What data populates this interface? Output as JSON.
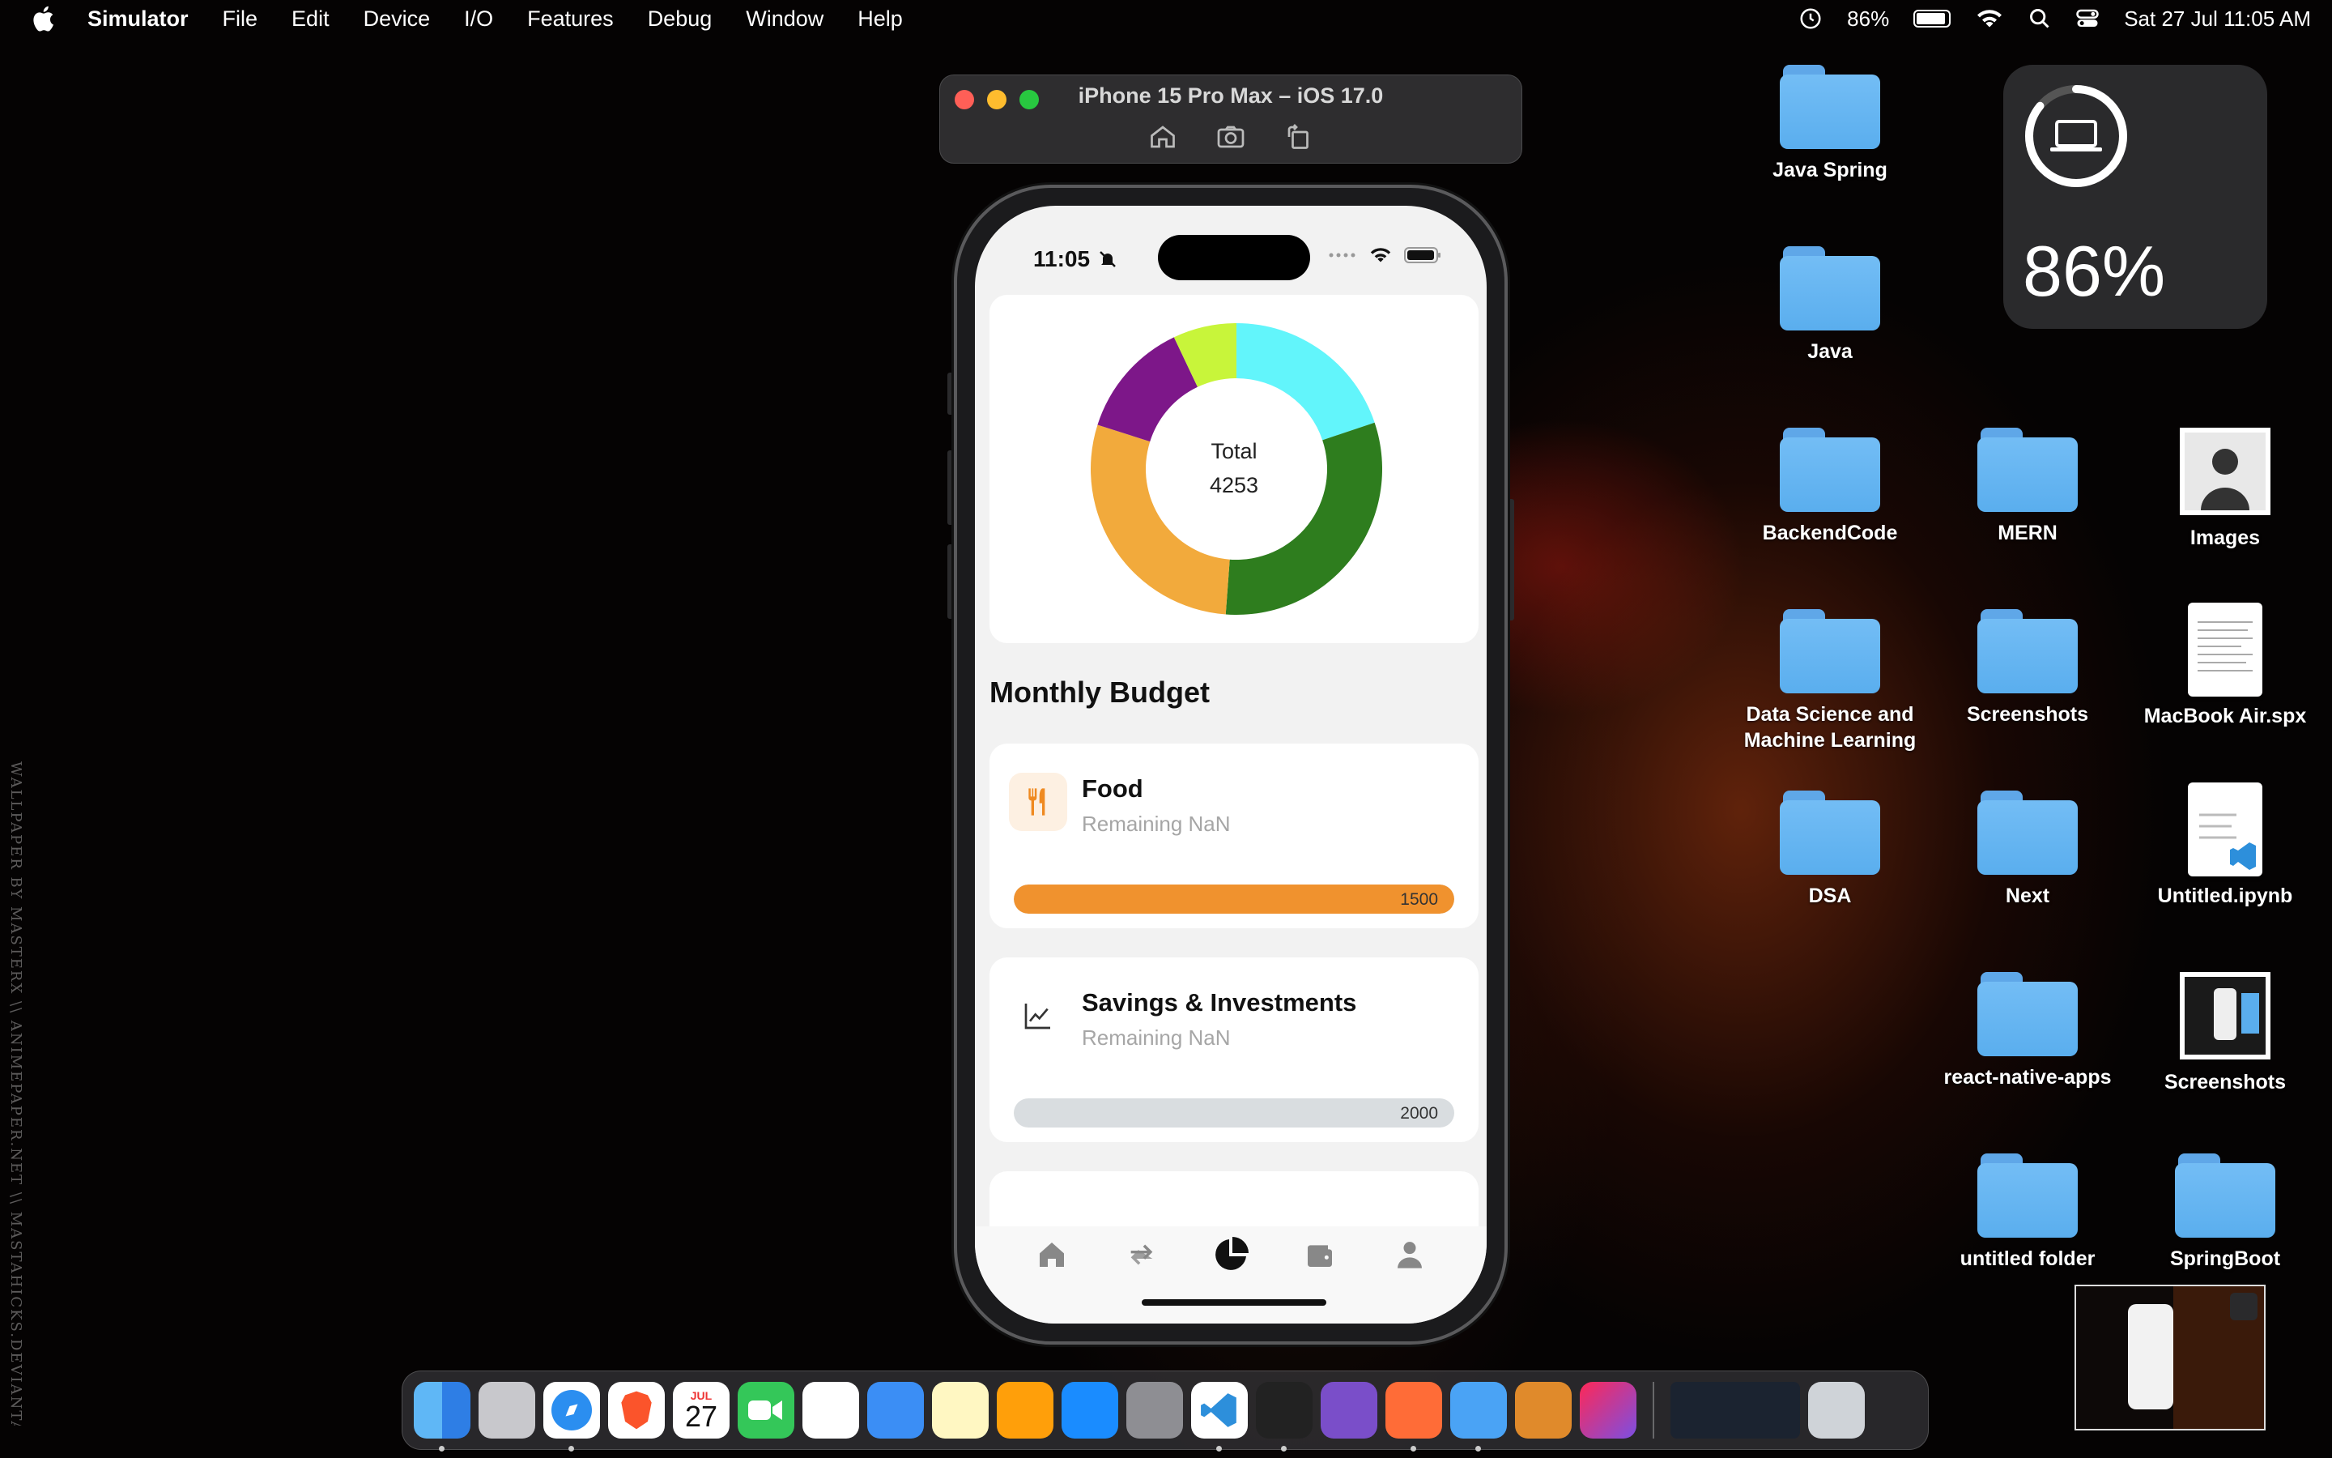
{
  "menubar": {
    "app_name": "Simulator",
    "items": [
      "File",
      "Edit",
      "Device",
      "I/O",
      "Features",
      "Debug",
      "Window",
      "Help"
    ],
    "battery_percent": "86%",
    "datetime": "Sat 27 Jul  11:05 AM"
  },
  "simulator": {
    "window_title": "iPhone 15 Pro Max – iOS 17.0",
    "toolbar_icons": [
      "home-icon",
      "screenshot-icon",
      "rotate-icon"
    ]
  },
  "phone": {
    "status_time": "11:05",
    "chart_center_title": "Total",
    "chart_center_value": "4253",
    "section_title": "Monthly Budget",
    "budgets": [
      {
        "name": "Food",
        "remaining": "Remaining NaN",
        "value": "1500",
        "icon": "fork-knife-icon",
        "fill_fraction": 1.0,
        "color": "#f0922e"
      },
      {
        "name": "Savings & Investments",
        "remaining": "Remaining NaN",
        "value": "2000",
        "icon": "trend-chart-icon",
        "fill_fraction": 0.0,
        "color": "#d9dde0"
      }
    ],
    "tabs": [
      "home-icon",
      "transfer-icon",
      "pie-chart-icon",
      "wallet-icon",
      "profile-icon"
    ],
    "active_tab": "pie-chart-icon"
  },
  "chart_data": {
    "type": "pie",
    "title": "",
    "labels": [],
    "values": [
      760,
      1200,
      1100,
      500,
      270
    ],
    "colors": [
      "#62f5fb",
      "#2e7d1e",
      "#f2aa3c",
      "#7d1789",
      "#c8f53a"
    ]
  },
  "desktop": {
    "icons": [
      {
        "label": "Java Spring",
        "type": "folder"
      },
      {
        "label": "Java",
        "type": "folder"
      },
      {
        "label": "BackendCode",
        "type": "folder"
      },
      {
        "label": "MERN",
        "type": "folder"
      },
      {
        "label": "Images",
        "type": "photo"
      },
      {
        "label": "Data Science and Machine Learning",
        "type": "folder"
      },
      {
        "label": "Screenshots",
        "type": "folder"
      },
      {
        "label": "MacBook Air.spx",
        "type": "document"
      },
      {
        "label": "DSA",
        "type": "folder"
      },
      {
        "label": "Next",
        "type": "folder"
      },
      {
        "label": "Untitled.ipynb",
        "type": "document"
      },
      {
        "label": "react-native-apps",
        "type": "folder"
      },
      {
        "label": "Screenshots",
        "type": "photo"
      },
      {
        "label": "untitled folder",
        "type": "folder"
      },
      {
        "label": "SpringBoot",
        "type": "folder"
      }
    ]
  },
  "widget": {
    "battery_percent": "86%",
    "icon": "laptop-icon"
  },
  "wallpaper_credit": "WALLPAPER BY MASTERX \\\\ ANIMEPAPER.NET \\\\ MASTAHICKS.DEVIANTART.COM",
  "dock": {
    "calendar_month": "JUL",
    "calendar_day": "27",
    "apps": [
      "Finder",
      "Launchpad",
      "Safari",
      "Brave",
      "Calendar",
      "FaceTime",
      "Reminders",
      "Mail",
      "Notes",
      "Pages",
      "App Store",
      "System Settings",
      "Visual Studio Code",
      "Terminal",
      "GitHub Desktop",
      "Postman",
      "Xcode",
      "Reeder",
      "IntelliJ IDEA",
      "Trash"
    ]
  }
}
